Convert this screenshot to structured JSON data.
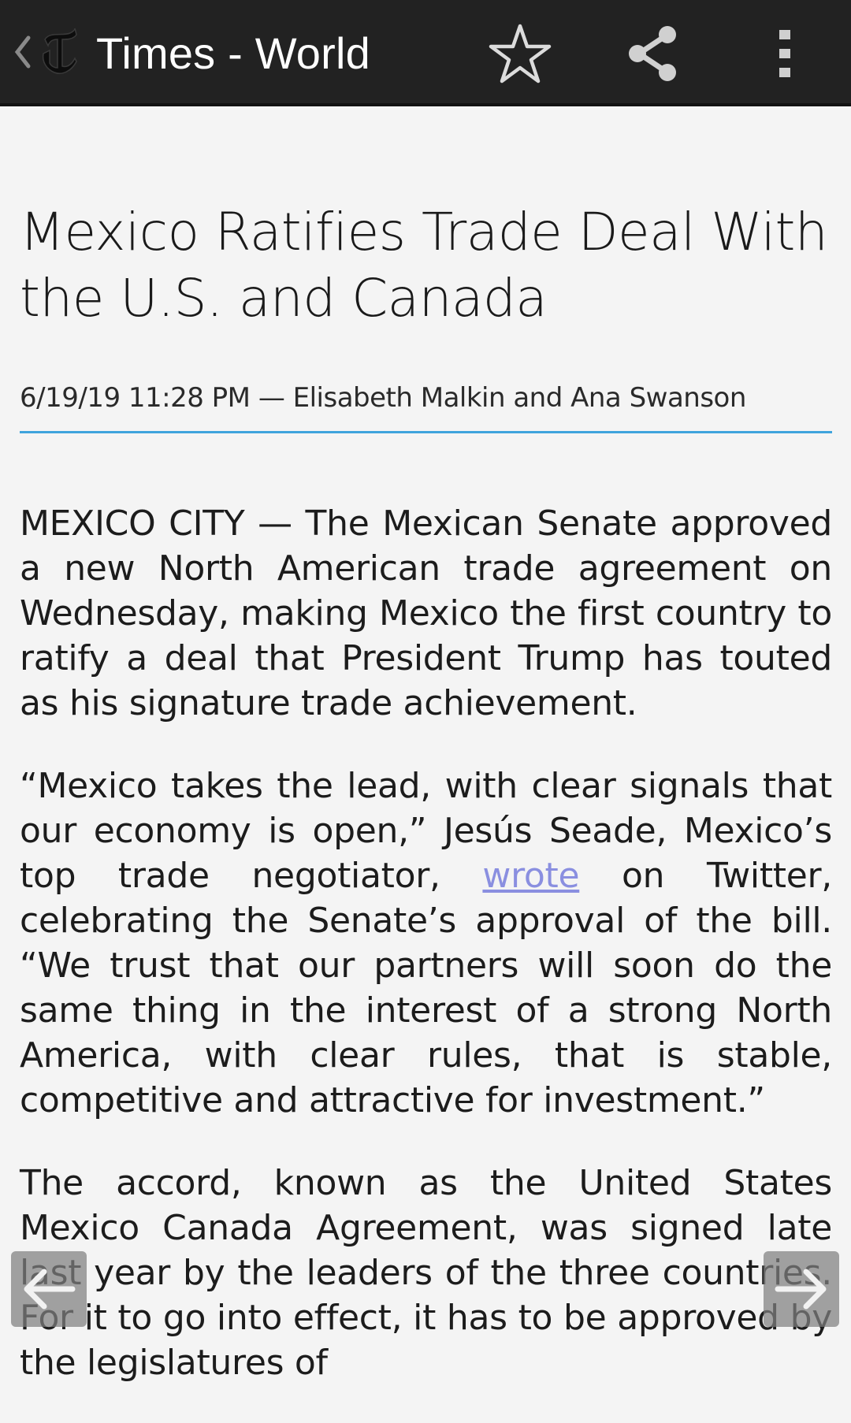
{
  "appbar": {
    "title": "Times - World",
    "icons": [
      "back-chevron-icon",
      "nyt-logo-icon",
      "star-icon",
      "share-icon",
      "more-vert-icon"
    ]
  },
  "article": {
    "headline": "Mexico Ratifies Trade Deal With the U.S. and Canada",
    "meta": "6/19/19 11:28 PM — Elisabeth Malkin and Ana Swanson",
    "paragraphs": {
      "p1": "MEXICO CITY — The Mexican Senate approved a new North American trade agreement on Wednesday, making Mexico the first country to ratify a deal that President Trump has touted as his signature trade achievement.",
      "p2_before": "“Mexico takes the lead, with clear signals that our economy is open,” Jesús Seade, Mexico’s top trade negotiator, ",
      "p2_link": "wrote",
      "p2_after": " on Twitter, celebrating the Senate’s approval of the bill. “We trust that our partners will soon do the same thing in the interest of a strong North America, with clear rules, that is stable, competitive and attractive for investment.”",
      "p3": "The accord, known as the United States Mexico Canada Agreement, was signed late last year by the leaders of the three countries. For it to go into effect, it has to be approved by the legislatures of"
    }
  },
  "colors": {
    "appbar_bg": "#222222",
    "divider": "#3fa4dc",
    "link": "#8a8fe0",
    "page_bg": "#f4f4f4"
  }
}
